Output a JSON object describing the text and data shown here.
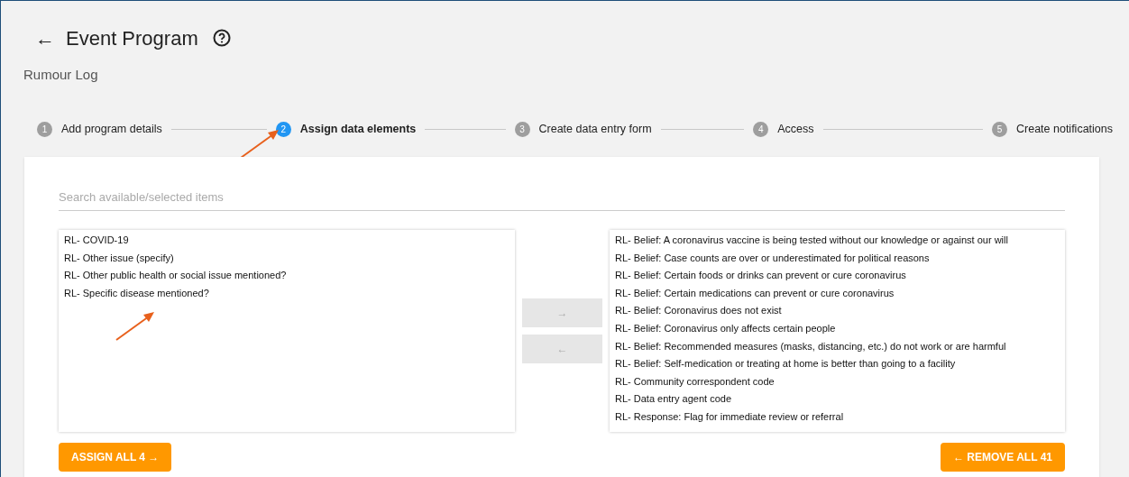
{
  "header": {
    "back_icon": "←",
    "title": "Event Program"
  },
  "subtitle": "Rumour Log",
  "steps": [
    {
      "number": "1",
      "label": "Add program details",
      "selected": false
    },
    {
      "number": "2",
      "label": "Assign data elements",
      "selected": true
    },
    {
      "number": "3",
      "label": "Create data entry form",
      "selected": false
    },
    {
      "number": "4",
      "label": "Access",
      "selected": false
    },
    {
      "number": "5",
      "label": "Create notifications",
      "selected": false
    }
  ],
  "search": {
    "placeholder": "Search available/selected items"
  },
  "available": [
    "RL- COVID-19",
    "RL- Other issue (specify)",
    "RL- Other public health or social issue mentioned?",
    "RL- Specific disease mentioned?"
  ],
  "selected_items": [
    "RL- Belief: A coronavirus vaccine is being tested without our knowledge or against our will",
    "RL- Belief: Case counts are over or underestimated for political reasons",
    "RL- Belief: Certain foods or drinks can prevent or cure coronavirus",
    "RL- Belief: Certain medications can prevent or cure coronavirus",
    "RL- Belief: Coronavirus does not exist",
    "RL- Belief: Coronavirus only affects certain people",
    "RL- Belief: Recommended measures (masks, distancing, etc.) do not work or are harmful",
    "RL- Belief: Self-medication or treating at home is better than going to a facility",
    "RL- Community correspondent code",
    "RL- Data entry agent code",
    "RL- Response: Flag for immediate review or referral"
  ],
  "transfer_buttons": [
    {
      "label": "→",
      "disabled": true
    },
    {
      "label": "←",
      "disabled": true
    }
  ],
  "assign_all": "ASSIGN ALL 4 →",
  "remove_all": "← REMOVE ALL 41"
}
